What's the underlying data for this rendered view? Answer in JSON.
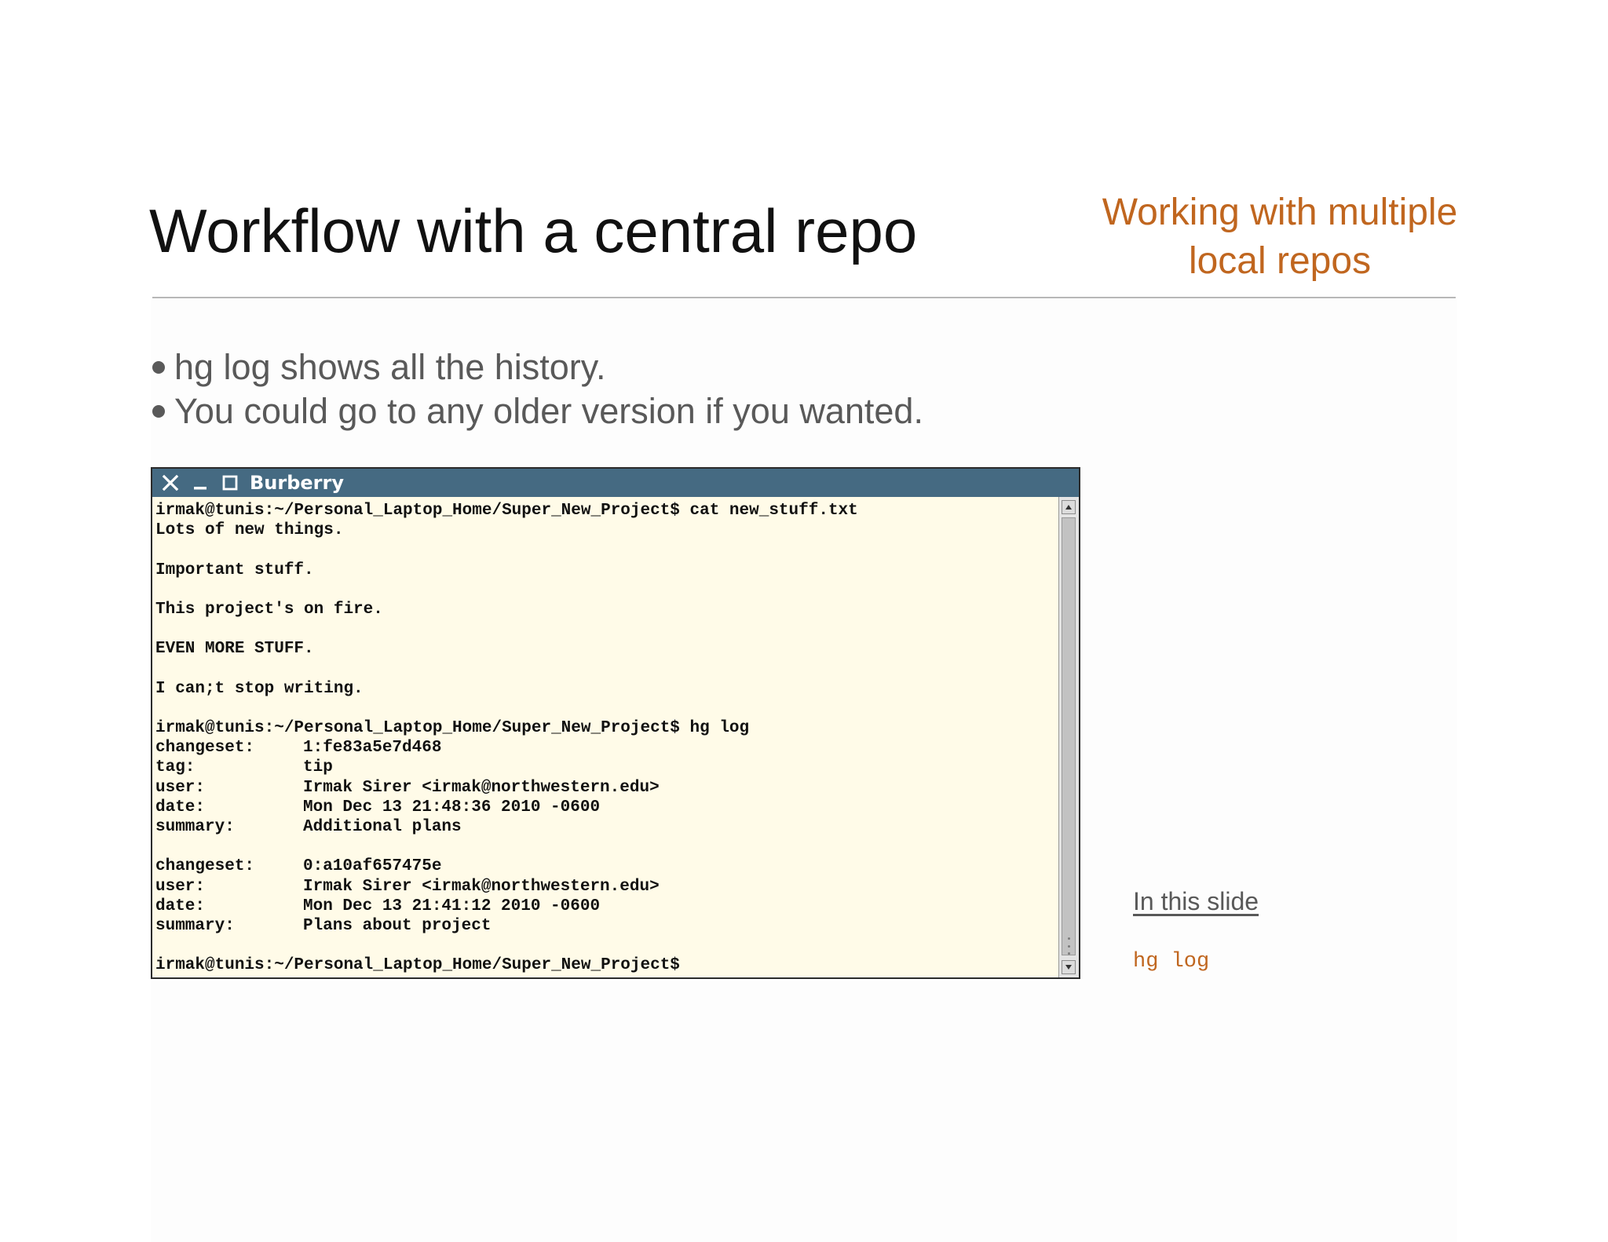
{
  "slide": {
    "title": "Workflow with a central repo",
    "section_title": "Working with multiple local repos",
    "bullets": [
      "hg log shows all the history.",
      "You could go to any older version if you wanted."
    ]
  },
  "terminal": {
    "window_title": "Burberry",
    "icons": {
      "close": "close-icon",
      "minimize": "minimize-icon",
      "maximize": "maximize-icon"
    },
    "lines": [
      "irmak@tunis:~/Personal_Laptop_Home/Super_New_Project$ cat new_stuff.txt",
      "Lots of new things.",
      "",
      "Important stuff.",
      "",
      "This project's on fire.",
      "",
      "EVEN MORE STUFF.",
      "",
      "I can;t stop writing.",
      "",
      "irmak@tunis:~/Personal_Laptop_Home/Super_New_Project$ hg log",
      {
        "key": "changeset:",
        "value": "1:fe83a5e7d468"
      },
      {
        "key": "tag:",
        "value": "tip"
      },
      {
        "key": "user:",
        "value": "Irmak Sirer <irmak@northwestern.edu>"
      },
      {
        "key": "date:",
        "value": "Mon Dec 13 21:48:36 2010 -0600"
      },
      {
        "key": "summary:",
        "value": "Additional plans"
      },
      "",
      {
        "key": "changeset:",
        "value": "0:a10af657475e"
      },
      {
        "key": "user:",
        "value": "Irmak Sirer <irmak@northwestern.edu>"
      },
      {
        "key": "date:",
        "value": "Mon Dec 13 21:41:12 2010 -0600"
      },
      {
        "key": "summary:",
        "value": "Plans about project"
      },
      "",
      "irmak@tunis:~/Personal_Laptop_Home/Super_New_Project$"
    ]
  },
  "aside": {
    "heading": "In this slide",
    "code": "hg log"
  },
  "colors": {
    "accent": "#c0661f",
    "titlebar": "#456a82",
    "terminal_bg": "#fffbe8",
    "body_text": "#595959"
  }
}
